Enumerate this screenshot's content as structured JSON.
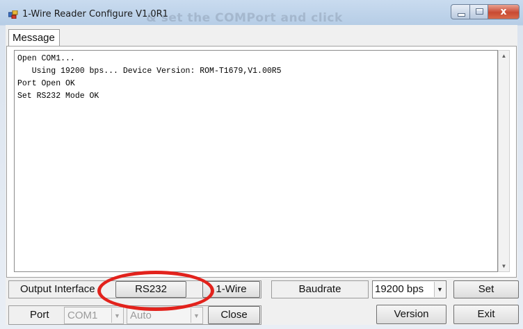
{
  "window": {
    "title": "1-Wire Reader Configure V1.0R1",
    "ghost_text": "& set the COMPort and click",
    "controls": {
      "minimize": "minimize",
      "maximize": "maximize",
      "close": "x"
    }
  },
  "tab": {
    "label": "Message"
  },
  "log": {
    "lines": [
      "Open COM1...",
      "   Using 19200 bps... Device Version: ROM-T1679,V1.00R5",
      "Port Open OK",
      "Set RS232 Mode OK"
    ]
  },
  "row1": {
    "output_interface_label": "Output Interface",
    "rs232_label": "RS232",
    "onewire_label": "1-Wire",
    "baudrate_label": "Baudrate",
    "baudrate_value": "19200 bps",
    "set_label": "Set"
  },
  "row2": {
    "port_label": "Port",
    "com_value": "COM1",
    "auto_value": "Auto",
    "close_label": "Close",
    "version_label": "Version",
    "exit_label": "Exit"
  },
  "colors": {
    "annotation_ring": "#e2221c",
    "titlebar": "#c9dbef",
    "close_button": "#c84a33"
  }
}
